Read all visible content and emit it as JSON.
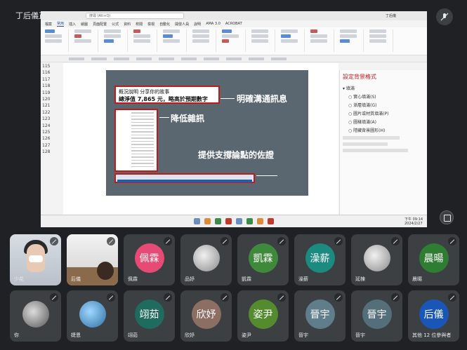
{
  "presenter_label": "丁后儀正在分享螢幕畫面",
  "excel": {
    "search_placeholder": "搜尋 (Alt+Q)",
    "user": "丁后儀",
    "tabs": [
      "檔案",
      "常用",
      "插入",
      "繪圖",
      "頁面配置",
      "公式",
      "資料",
      "校閱",
      "檢視",
      "自動化",
      "開發人員",
      "說明",
      "AMA 3.0",
      "ACROBAT"
    ],
    "active_tab": "常用",
    "row_numbers": [
      "115",
      "116",
      "117",
      "118",
      "119",
      "120",
      "121",
      "122",
      "123",
      "124",
      "125",
      "126",
      "127",
      "128"
    ]
  },
  "slide": {
    "box1_line1": "概況說明 分享你的故事",
    "box1_line2": "總淨值 7,865 元，略高於預期數字"
  },
  "annotations": {
    "a1": "明確溝通訊息",
    "a2": "降低雜訊",
    "a3": "提供支撐論點的佐證"
  },
  "pane": {
    "title": "設定背景格式",
    "items": [
      "填滿",
      "實心填滿(S)",
      "漸層填滿(G)",
      "圖片或材質填滿(P)",
      "圖樣填滿(A)",
      "隱藏背景圖形(H)"
    ]
  },
  "status": {
    "time": "下午 09:14",
    "date": "2024/2/27"
  },
  "participants": [
    {
      "name": "少花",
      "type": "camera1"
    },
    {
      "name": "后儀",
      "type": "camera2"
    },
    {
      "name": "佩霖",
      "type": "avatar",
      "initials": "佩霖",
      "color": "#e64a75"
    },
    {
      "name": "品妤",
      "type": "photo",
      "style": "light"
    },
    {
      "name": "凱霖",
      "type": "avatar",
      "initials": "凱霖",
      "color": "#3f8a3a"
    },
    {
      "name": "澡薪",
      "type": "avatar",
      "initials": "澡薪",
      "color": "#1b8a7f"
    },
    {
      "name": "延棟",
      "type": "photo",
      "style": "light"
    },
    {
      "name": "晨暘",
      "type": "avatar",
      "initials": "晨暘",
      "color": "#2e7d32"
    },
    {
      "name": "你",
      "type": "photo",
      "style": "dark"
    },
    {
      "name": "婕恩",
      "type": "photo",
      "style": "blue"
    },
    {
      "name": "翊茹",
      "type": "avatar",
      "initials": "翊茹",
      "color": "#1f6b5e"
    },
    {
      "name": "欣妤",
      "type": "avatar",
      "initials": "欣妤",
      "color": "#8d6e63"
    },
    {
      "name": "姿尹",
      "type": "avatar",
      "initials": "姿尹",
      "color": "#558b2f"
    },
    {
      "name": "晉宇",
      "type": "avatar",
      "initials": "晉宇",
      "color": "#607d8b"
    },
    {
      "name": "晉宇",
      "type": "avatar",
      "initials": "晉宇",
      "color": "#546e7a"
    },
    {
      "name": "其他 12 位參與者",
      "type": "avatar",
      "initials": "后儀",
      "color": "#1a56b8"
    }
  ]
}
